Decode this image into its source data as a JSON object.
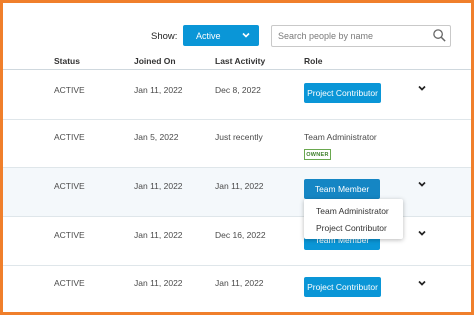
{
  "filters": {
    "show_label": "Show:",
    "status_value": "Active",
    "search_placeholder": "Search people by name"
  },
  "table": {
    "headers": {
      "status": "Status",
      "joined": "Joined On",
      "last_activity": "Last Activity",
      "role": "Role"
    },
    "rows": [
      {
        "status": "ACTIVE",
        "joined": "Jan 11, 2022",
        "last_activity": "Dec 8, 2022",
        "role": "Project Contributor"
      },
      {
        "status": "ACTIVE",
        "joined": "Jan 5, 2022",
        "last_activity": "Just recently",
        "role": "Team Administrator",
        "badge": "OWNER"
      },
      {
        "status": "ACTIVE",
        "joined": "Jan 11, 2022",
        "last_activity": "Jan 11, 2022",
        "role": "Team Member"
      },
      {
        "status": "ACTIVE",
        "joined": "Jan 11, 2022",
        "last_activity": "Dec 16, 2022",
        "role": "Team Member"
      },
      {
        "status": "ACTIVE",
        "joined": "Jan 11, 2022",
        "last_activity": "Jan 11, 2022",
        "role": "Project Contributor"
      }
    ]
  },
  "role_dropdown": {
    "options": [
      "Team Administrator",
      "Project Contributor"
    ]
  },
  "colors": {
    "accent": "#0a96d7",
    "frame": "#f07f2b",
    "owner_badge": "#6aa84f"
  },
  "icons": {
    "select_chevron": "chevron-down-icon",
    "search": "search-icon",
    "row_chevron": "chevron-down-icon"
  }
}
